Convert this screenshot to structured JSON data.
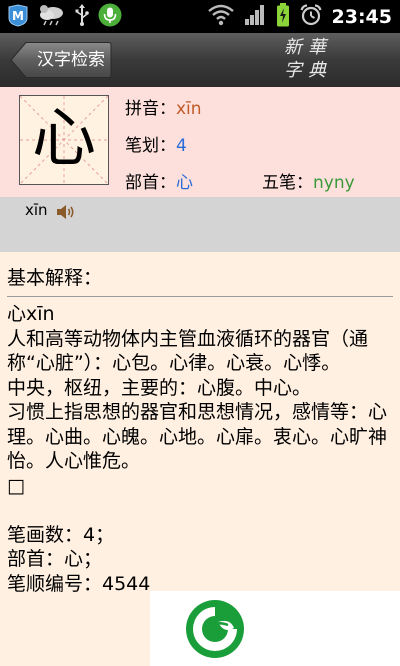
{
  "status_bar": {
    "time": "23:45",
    "icons": [
      "maps-icon",
      "weather-icon",
      "usb-icon",
      "microphone-icon",
      "wifi-icon",
      "signal-icon",
      "battery-charging-icon",
      "alarm-icon"
    ]
  },
  "titlebar": {
    "back_label": "汉字检索",
    "logo_line1": "新華",
    "logo_line2": "字典"
  },
  "character": {
    "glyph": "心",
    "pinyin_label": "拼音：",
    "pinyin": "xīn",
    "strokes_label": "笔划：",
    "strokes": "4",
    "radical_label": "部首：",
    "radical": "心",
    "wubi_label": "五笔：",
    "wubi": "nyny"
  },
  "pronunciation": {
    "text": "xīn"
  },
  "content": {
    "section_title": "基本解释：",
    "body": "心xīn\n人和高等动物体内主管血液循环的器官（通称“心脏”）：心包。心律。心衰。心悸。\n中央，枢纽，主要的：心腹。中心。\n习惯上指思想的器官和思想情况，感情等：心理。心曲。心魄。心地。心扉。衷心。心旷神怡。人心惟危。\n□\n\n笔画数：4；\n部首：心；\n笔顺编号：4544"
  },
  "colors": {
    "char_panel_bg": "#fde0dc",
    "content_bg": "#fff0e2",
    "pinyin": "#c05a28",
    "link_blue": "#2a6cd8",
    "wubi_green": "#3a9a3a",
    "logo_green": "#1a9e3a"
  }
}
